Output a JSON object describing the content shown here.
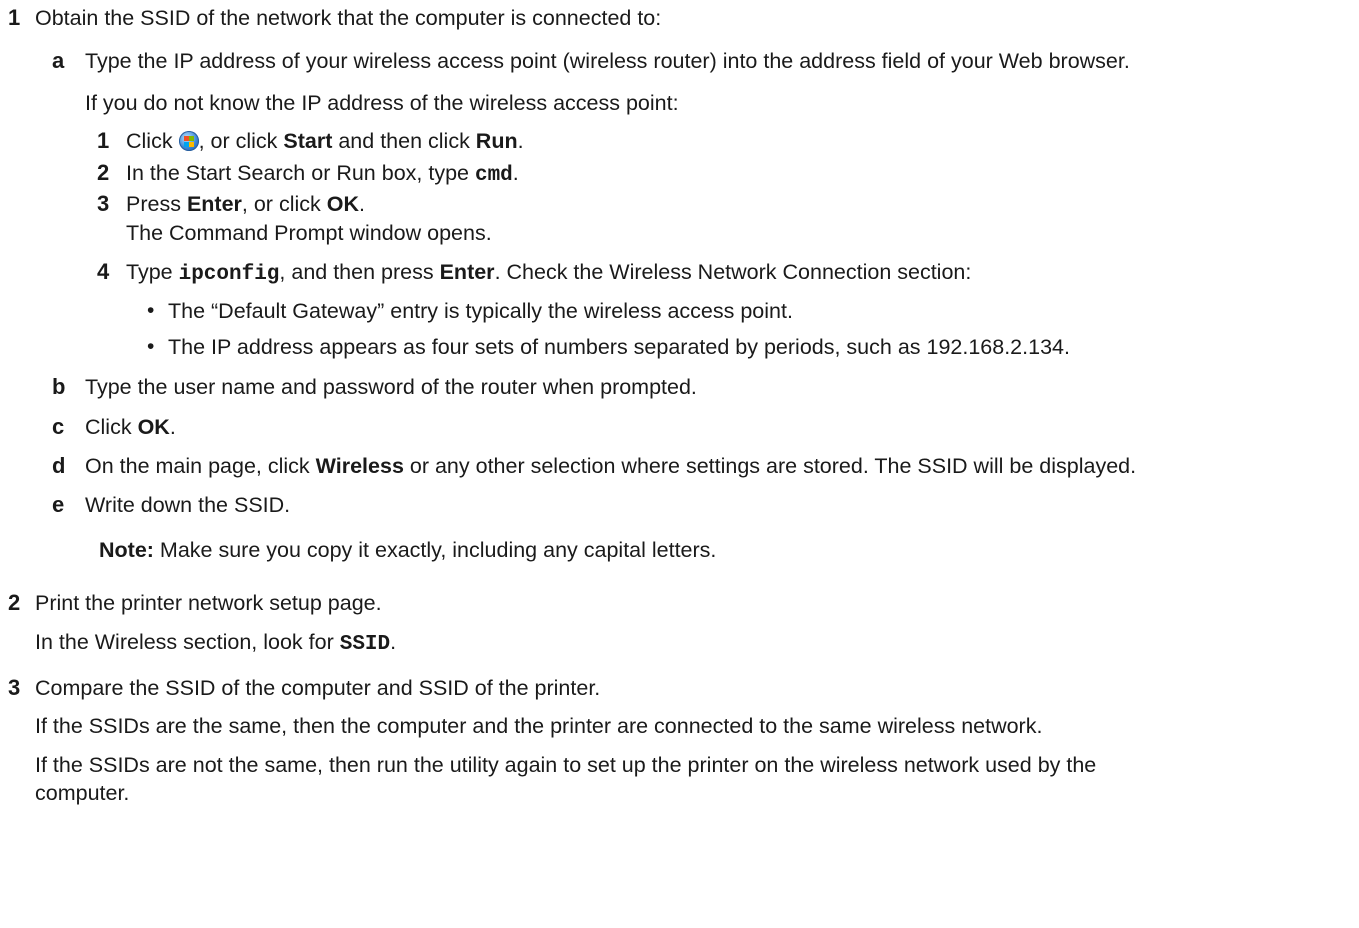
{
  "steps": {
    "s1": {
      "num": "1",
      "text": "Obtain the SSID of the network that the computer is connected to:",
      "a": {
        "letter": "a",
        "text": "Type the IP address of your wireless access point (wireless router) into the address field of your Web browser.",
        "intro": "If you do not know the IP address of the wireless access point:",
        "sub1": {
          "num": "1",
          "pre": "Click ",
          "icon": "windows-start-orb-icon",
          "mid": ", or click ",
          "start": "Start",
          "and": " and then click ",
          "run": "Run",
          "end": "."
        },
        "sub2": {
          "num": "2",
          "pre": "In the Start Search or Run box, type ",
          "cmd": "cmd",
          "end": "."
        },
        "sub3": {
          "num": "3",
          "pre": "Press ",
          "enter": "Enter",
          "mid": ", or click ",
          "ok": "OK",
          "end": ".",
          "note": "The Command Prompt window opens."
        },
        "sub4": {
          "num": "4",
          "pre": "Type ",
          "cmd": "ipconfig",
          "mid": ", and then press ",
          "enter": "Enter",
          "post": ". Check the Wireless Network Connection section:",
          "bullets": [
            "The “Default Gateway” entry is typically the wireless access point.",
            "The IP address appears as four sets of numbers separated by periods, such as 192.168.2.134."
          ]
        }
      },
      "b": {
        "letter": "b",
        "text": "Type the user name and password of the router when prompted."
      },
      "c": {
        "letter": "c",
        "pre": "Click ",
        "ok": "OK",
        "end": "."
      },
      "d": {
        "letter": "d",
        "pre": "On the main page, click ",
        "wireless": "Wireless",
        "post": " or any other selection where settings are stored. The SSID will be displayed."
      },
      "e": {
        "letter": "e",
        "text": "Write down the SSID."
      },
      "note": {
        "label": "Note:",
        "text": " Make sure you copy it exactly, including any capital letters."
      }
    },
    "s2": {
      "num": "2",
      "text": "Print the printer network setup page.",
      "pre": "In the Wireless section, look for ",
      "ssid": "SSID",
      "end": "."
    },
    "s3": {
      "num": "3",
      "text": "Compare the SSID of the computer and SSID of the printer.",
      "p1": "If the SSIDs are the same, then the computer and the printer are connected to the same wireless network.",
      "p2a": "If the SSIDs are not the same, then run the utility again to set up the printer on the wireless network used by the",
      "p2b": "computer."
    },
    "bullet_char": "•"
  }
}
